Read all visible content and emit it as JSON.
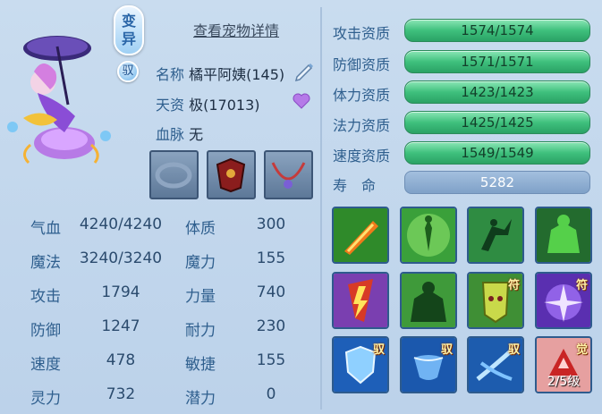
{
  "header": {
    "transform_badge": "变异",
    "ride_badge": "驭",
    "detail_link": "查看宠物详情"
  },
  "pet": {
    "name_label": "名称",
    "name_value": "橘平阿姨(145)",
    "aptitude_label": "天资",
    "aptitude_value": "极(17013)",
    "bloodline_label": "血脉",
    "bloodline_value": "无"
  },
  "stats": [
    {
      "label": "气血",
      "value": "4240/4240",
      "label2": "体质",
      "value2": "300"
    },
    {
      "label": "魔法",
      "value": "3240/3240",
      "label2": "魔力",
      "value2": "155"
    },
    {
      "label": "攻击",
      "value": "1794",
      "label2": "力量",
      "value2": "740"
    },
    {
      "label": "防御",
      "value": "1247",
      "label2": "耐力",
      "value2": "230"
    },
    {
      "label": "速度",
      "value": "478",
      "label2": "敏捷",
      "value2": "155"
    },
    {
      "label": "灵力",
      "value": "732",
      "label2": "潜力",
      "value2": "0"
    }
  ],
  "aptitudes": [
    {
      "label": "攻击资质",
      "value": "1574/1574",
      "fill": 1.0
    },
    {
      "label": "防御资质",
      "value": "1571/1571",
      "fill": 1.0
    },
    {
      "label": "体力资质",
      "value": "1423/1423",
      "fill": 1.0
    },
    {
      "label": "法力资质",
      "value": "1425/1425",
      "fill": 1.0
    },
    {
      "label": "速度资质",
      "value": "1549/1549",
      "fill": 1.0
    }
  ],
  "life": {
    "label": "寿　命",
    "value": "5282"
  },
  "skills": [
    {
      "icon": "flame-sword-icon",
      "tag": ""
    },
    {
      "icon": "figure-glow-icon",
      "tag": ""
    },
    {
      "icon": "leaping-figure-icon",
      "tag": ""
    },
    {
      "icon": "green-giant-icon",
      "tag": ""
    },
    {
      "icon": "thunder-blade-icon",
      "tag": ""
    },
    {
      "icon": "brute-shadow-icon",
      "tag": ""
    },
    {
      "icon": "totem-mask-icon",
      "tag": "符"
    },
    {
      "icon": "purple-burst-icon",
      "tag": "符"
    },
    {
      "icon": "blue-shield-icon",
      "tag": "驭"
    },
    {
      "icon": "blue-cup-icon",
      "tag": "驭"
    },
    {
      "icon": "blue-slash-icon",
      "tag": "驭"
    },
    {
      "icon": "awaken-red-icon",
      "tag": "觉",
      "level": "2/5级"
    }
  ]
}
